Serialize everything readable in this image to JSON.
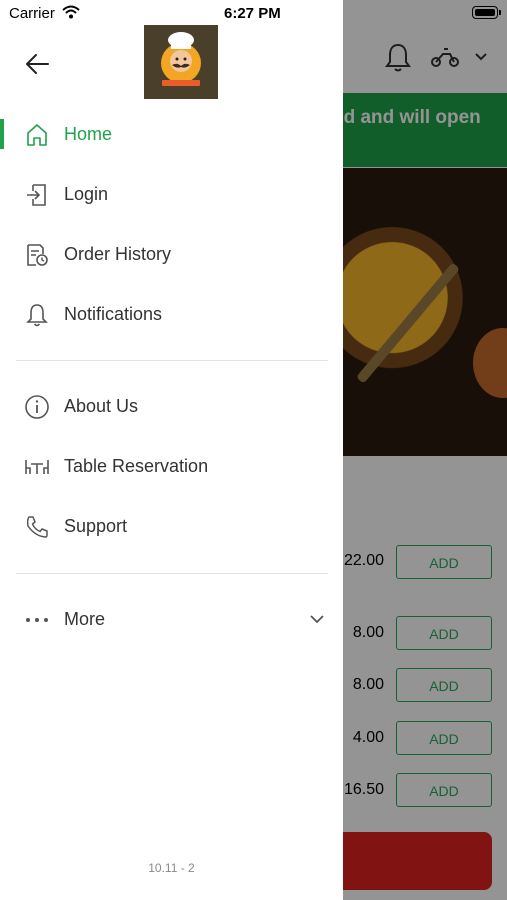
{
  "status_bar": {
    "carrier": "Carrier",
    "time": "6:27 PM"
  },
  "drawer": {
    "menu": [
      {
        "label": "Home",
        "icon": "home-icon",
        "active": true
      },
      {
        "label": "Login",
        "icon": "login-icon"
      },
      {
        "label": "Order History",
        "icon": "order-history-icon"
      },
      {
        "label": "Notifications",
        "icon": "bell-icon"
      },
      {
        "label": "About Us",
        "icon": "info-icon"
      },
      {
        "label": "Table Reservation",
        "icon": "table-icon"
      },
      {
        "label": "Support",
        "icon": "phone-icon"
      },
      {
        "label": "More",
        "icon": "more-dots-icon"
      }
    ],
    "version": "10.11 - 2"
  },
  "background": {
    "banner_text": "ed and will open",
    "prices": [
      "22.00",
      "8.00",
      "8.00",
      "4.00",
      "16.50"
    ],
    "add_label": "ADD"
  },
  "colors": {
    "accent": "#1fa24a",
    "cta": "#e02121"
  }
}
